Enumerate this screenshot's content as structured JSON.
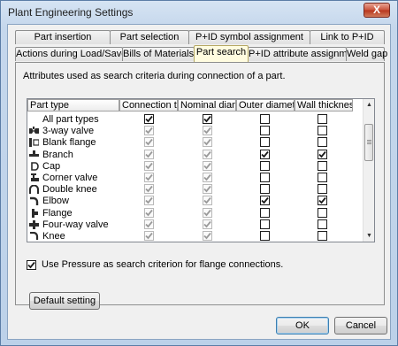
{
  "window": {
    "title": "Plant Engineering Settings",
    "close_glyph": "X"
  },
  "tabs_back": [
    {
      "label": "Part insertion"
    },
    {
      "label": "Part selection"
    },
    {
      "label": "P+ID symbol assignment"
    },
    {
      "label": "Link to P+ID"
    }
  ],
  "tabs_front": [
    {
      "label": "Actions during Load/Save"
    },
    {
      "label": "Bills of Materials"
    },
    {
      "label": "Part search",
      "active": true
    },
    {
      "label": "P+ID attribute assignment"
    },
    {
      "label": "Weld gap"
    }
  ],
  "description": "Attributes used as search criteria during connection of a part.",
  "grid": {
    "columns": [
      "Part type",
      "Connection t...",
      "Nominal diam...",
      "Outer diameter",
      "Wall thickness"
    ],
    "rows": [
      {
        "name": "All part types",
        "icon": "none-icon",
        "checks": [
          true,
          true,
          false,
          false
        ],
        "disabled": [
          false,
          false,
          false,
          false
        ]
      },
      {
        "name": "3-way valve",
        "icon": "three-way-valve-icon",
        "checks": [
          true,
          true,
          false,
          false
        ],
        "disabled": [
          true,
          true,
          false,
          false
        ]
      },
      {
        "name": "Blank flange",
        "icon": "blank-flange-icon",
        "checks": [
          true,
          true,
          false,
          false
        ],
        "disabled": [
          true,
          true,
          false,
          false
        ]
      },
      {
        "name": "Branch",
        "icon": "branch-icon",
        "checks": [
          true,
          true,
          true,
          true
        ],
        "disabled": [
          true,
          true,
          false,
          false
        ]
      },
      {
        "name": "Cap",
        "icon": "cap-icon",
        "checks": [
          true,
          true,
          false,
          false
        ],
        "disabled": [
          true,
          true,
          false,
          false
        ]
      },
      {
        "name": "Corner valve",
        "icon": "corner-valve-icon",
        "checks": [
          true,
          true,
          false,
          false
        ],
        "disabled": [
          true,
          true,
          false,
          false
        ]
      },
      {
        "name": "Double knee",
        "icon": "double-knee-icon",
        "checks": [
          true,
          true,
          false,
          false
        ],
        "disabled": [
          true,
          true,
          false,
          false
        ]
      },
      {
        "name": "Elbow",
        "icon": "elbow-icon",
        "checks": [
          true,
          true,
          true,
          true
        ],
        "disabled": [
          true,
          true,
          false,
          false
        ]
      },
      {
        "name": "Flange",
        "icon": "flange-icon",
        "checks": [
          true,
          true,
          false,
          false
        ],
        "disabled": [
          true,
          true,
          false,
          false
        ]
      },
      {
        "name": "Four-way valve",
        "icon": "four-way-valve-icon",
        "checks": [
          true,
          true,
          false,
          false
        ],
        "disabled": [
          true,
          true,
          false,
          false
        ]
      },
      {
        "name": "Knee",
        "icon": "knee-icon",
        "checks": [
          true,
          true,
          false,
          false
        ],
        "disabled": [
          true,
          true,
          false,
          false
        ]
      }
    ]
  },
  "pressure_option": {
    "label": "Use Pressure as search criterion for flange connections.",
    "checked": true
  },
  "buttons": {
    "default_setting": "Default setting",
    "ok": "OK",
    "cancel": "Cancel"
  }
}
